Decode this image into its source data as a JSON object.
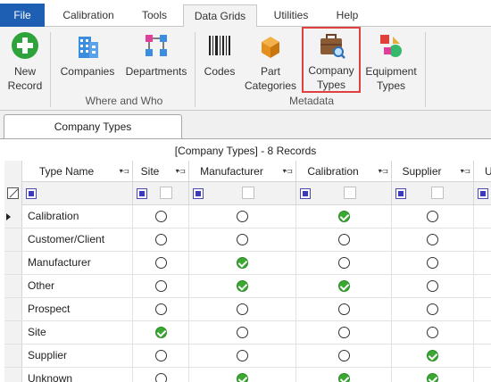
{
  "menu": {
    "tabs": [
      "File",
      "Calibration",
      "Tools",
      "Data Grids",
      "Utilities",
      "Help"
    ],
    "active": "Data Grids"
  },
  "ribbon": {
    "buttons": {
      "new_record": "New Record",
      "companies": "Companies",
      "departments": "Departments",
      "codes": "Codes",
      "part_categories": "Part Categories",
      "company_types": "Company Types",
      "equipment_types": "Equipment Types"
    },
    "groups": {
      "where_and_who": "Where and Who",
      "metadata": "Metadata"
    },
    "selected": "company_types"
  },
  "document_tab": "Company Types",
  "grid": {
    "caption": "[Company Types] - 8 Records",
    "columns": [
      "Type Name",
      "Site",
      "Manufacturer",
      "Calibration",
      "Supplier",
      "U"
    ],
    "rows": [
      {
        "name": "Calibration",
        "site": false,
        "manufacturer": false,
        "calibration": true,
        "supplier": false
      },
      {
        "name": "Customer/Client",
        "site": false,
        "manufacturer": false,
        "calibration": false,
        "supplier": false
      },
      {
        "name": "Manufacturer",
        "site": false,
        "manufacturer": true,
        "calibration": false,
        "supplier": false
      },
      {
        "name": "Other",
        "site": false,
        "manufacturer": true,
        "calibration": true,
        "supplier": false
      },
      {
        "name": "Prospect",
        "site": false,
        "manufacturer": false,
        "calibration": false,
        "supplier": false
      },
      {
        "name": "Site",
        "site": true,
        "manufacturer": false,
        "calibration": false,
        "supplier": false
      },
      {
        "name": "Supplier",
        "site": false,
        "manufacturer": false,
        "calibration": false,
        "supplier": true
      },
      {
        "name": "Unknown",
        "site": false,
        "manufacturer": true,
        "calibration": true,
        "supplier": true
      }
    ],
    "current_row": 0
  },
  "colors": {
    "file_tab": "#1e5fb4",
    "selection_border": "#e04040",
    "check_green": "#3aa832"
  }
}
